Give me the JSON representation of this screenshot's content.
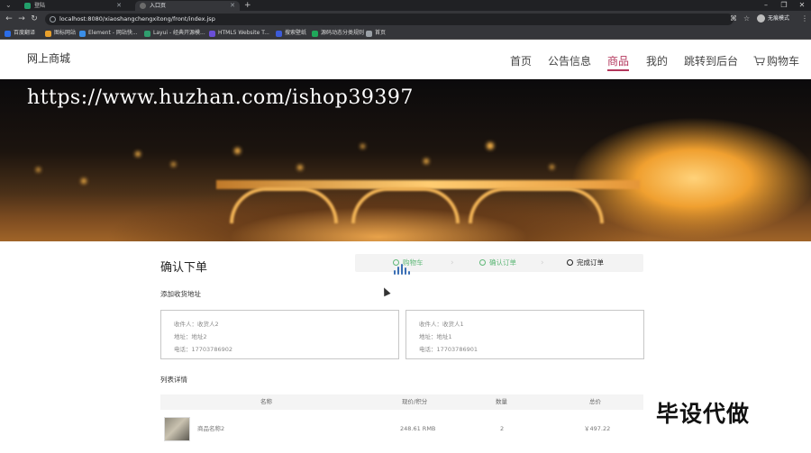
{
  "browser": {
    "tabs": [
      {
        "label": "登陆"
      },
      {
        "label": "入口页"
      }
    ],
    "url": "localhost:8080/xiaoshangchengxitong/front/index.jsp",
    "profile_label": "无痕模式",
    "bookmarks": [
      {
        "label": "百度翻译",
        "color": "#2b6de8"
      },
      {
        "label": "图标网站",
        "color": "#e8a02b"
      },
      {
        "label": "Element - 网站快...",
        "color": "#3b8fe8"
      },
      {
        "label": "Layui - 经典开源模...",
        "color": "#2f9e6e"
      },
      {
        "label": "HTML5 Website T...",
        "color": "#6a4fd8"
      },
      {
        "label": "搜索壁纸",
        "color": "#3c5bd8"
      },
      {
        "label": "源码动态分类规则",
        "color": "#1fa85a"
      },
      {
        "label": "首页",
        "color": "#9aa0a6"
      }
    ]
  },
  "site": {
    "logo": "网上商城",
    "nav": [
      {
        "label": "首页"
      },
      {
        "label": "公告信息"
      },
      {
        "label": "商品",
        "active": true
      },
      {
        "label": "我的"
      },
      {
        "label": "跳转到后台"
      },
      {
        "label": "购物车"
      }
    ],
    "accent_color": "#b3375c",
    "success_color": "#5fb878"
  },
  "banner": {
    "watermark": "https://www.huzhan.com/ishop39397"
  },
  "order": {
    "title": "确认下单",
    "steps": [
      {
        "label": "购物车",
        "state": "done"
      },
      {
        "label": "确认订单",
        "state": "done"
      },
      {
        "label": "完成订单",
        "state": "current"
      }
    ],
    "address_section_label": "添加收货地址",
    "addresses": [
      {
        "receiver": "收件人：收货人2",
        "address": "地址：地址2",
        "phone": "电话：17703786902"
      },
      {
        "receiver": "收件人：收货人1",
        "address": "地址：地址1",
        "phone": "电话：17703786901"
      }
    ],
    "list_section_label": "列表详情",
    "table": {
      "columns": [
        "名称",
        "现价/积分",
        "数量",
        "总价"
      ],
      "rows": [
        {
          "name": "商品名称2",
          "price": "248.61 RMB",
          "qty": "2",
          "total": "￥497.22"
        }
      ]
    }
  },
  "overlay_text": "毕设代做"
}
